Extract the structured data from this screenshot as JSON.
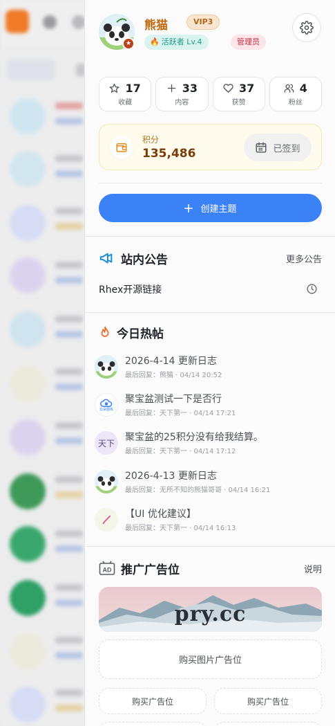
{
  "profile": {
    "username": "熊猫",
    "vip": "VIP3",
    "level": "活跃者 Lv.4",
    "role": "管理员"
  },
  "stats": [
    {
      "value": "17",
      "label": "收藏",
      "icon": "star-icon"
    },
    {
      "value": "33",
      "label": "内容",
      "icon": "plus-icon"
    },
    {
      "value": "37",
      "label": "获赞",
      "icon": "heart-icon"
    },
    {
      "value": "4",
      "label": "粉丝",
      "icon": "users-icon"
    }
  ],
  "points": {
    "label": "积分",
    "value": "135,486",
    "checkin_label": "已签到"
  },
  "create_button": "创建主题",
  "announcements": {
    "title": "站内公告",
    "more": "更多公告",
    "items": [
      "Rhex开源链接"
    ]
  },
  "hot": {
    "title": "今日热帖",
    "items": [
      {
        "title": "2026-4-14 更新日志",
        "meta": "最后回复：熊猫 · 04/14 20:52",
        "avatar": "panda"
      },
      {
        "title": "聚宝盆测试一下是否行",
        "meta": "最后回复：天下第一 · 04/14 17:21",
        "avatar": "cloud",
        "avatar_text": "云朵图库"
      },
      {
        "title": "聚宝盆的25积分没有给我结算。",
        "meta": "最后回复：天下第一 · 04/14 17:12",
        "avatar": "text",
        "avatar_text": "天下"
      },
      {
        "title": "2026-4-13 更新日志",
        "meta": "最后回复：无所不知的熊猫哥哥 · 04/14 16:21",
        "avatar": "panda"
      },
      {
        "title": "【UI 优化建议】",
        "meta": "最后回复：天下第一 · 04/14 16:13",
        "avatar": "brush"
      }
    ]
  },
  "ads": {
    "badge": "AD",
    "title": "推广广告位",
    "link": "说明",
    "banner_text": "pry.cc",
    "buy_image": "购买图片广告位",
    "buy_left": "购买广告位",
    "buy_right": "购买广告位"
  },
  "colors": {
    "accent": "#3b82f6",
    "username": "#c06a10",
    "points_bg": "#fffbec"
  }
}
